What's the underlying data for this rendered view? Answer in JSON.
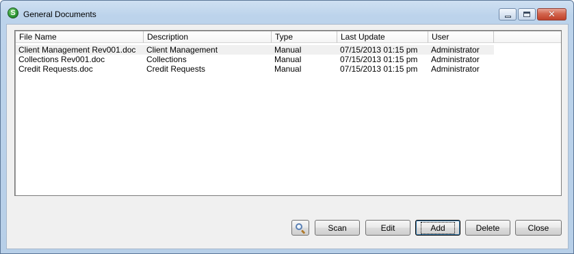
{
  "window": {
    "title": "General Documents",
    "app_icon_letter": "S",
    "icons": {
      "app": "app-logo-icon",
      "minimize": "minimize-icon",
      "maximize": "maximize-icon",
      "close": "close-icon"
    }
  },
  "list": {
    "columns": [
      "File Name",
      "Description",
      "Type",
      "Last Update",
      "User",
      ""
    ],
    "rows": [
      {
        "file_name": "Client Management Rev001.doc",
        "description": "Client Management",
        "type": "Manual",
        "last_update": "07/15/2013 01:15 pm",
        "user": "Administrator",
        "selected": true
      },
      {
        "file_name": "Collections Rev001.doc",
        "description": "Collections",
        "type": "Manual",
        "last_update": "07/15/2013 01:15 pm",
        "user": "Administrator",
        "selected": false
      },
      {
        "file_name": "Credit Requests.doc",
        "description": "Credit Requests",
        "type": "Manual",
        "last_update": "07/15/2013 01:15 pm",
        "user": "Administrator",
        "selected": false
      }
    ]
  },
  "buttons": {
    "search_icon": "magnifier-icon",
    "scan": "Scan",
    "edit": "Edit",
    "add": "Add",
    "delete": "Delete",
    "close": "Close"
  },
  "colors": {
    "window_frame": "#b7cfe8",
    "close_button": "#c0412a",
    "selected_row": "#f0f0f0"
  }
}
